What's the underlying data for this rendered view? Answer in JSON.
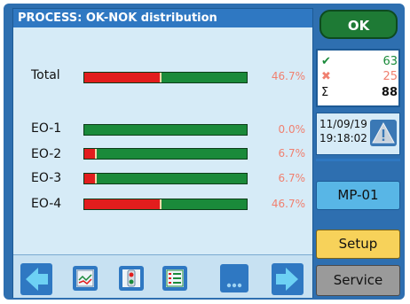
{
  "window": {
    "title": "PROCESS: OK-NOK distribution"
  },
  "rows": [
    {
      "label": "Total",
      "percent_text": "46.7%",
      "nok_fraction": 0.467
    },
    {
      "label": "EO-1",
      "percent_text": "0.0%",
      "nok_fraction": 0.0
    },
    {
      "label": "EO-2",
      "percent_text": "6.7%",
      "nok_fraction": 0.067
    },
    {
      "label": "EO-3",
      "percent_text": "6.7%",
      "nok_fraction": 0.067
    },
    {
      "label": "EO-4",
      "percent_text": "46.7%",
      "nok_fraction": 0.467
    }
  ],
  "side": {
    "ok_label": "OK",
    "counts": {
      "ok": {
        "symbol": "✔",
        "value": "63"
      },
      "nok": {
        "symbol": "✖",
        "value": "25"
      },
      "total": {
        "symbol": "Σ",
        "value": "88"
      }
    },
    "date": "11/09/19",
    "time": "19:18:02",
    "mp_label": "MP-01",
    "setup_label": "Setup",
    "service_label": "Service"
  },
  "colors": {
    "ok_bar": "#1a8a3a",
    "nok_bar": "#e21d1d",
    "percent_text": "#f08070",
    "ok_count": "#1a8a3a",
    "nok_count": "#f08070"
  },
  "toolbar": {
    "icons": [
      "arrow-left-icon",
      "trend-chart-icon",
      "traffic-light-icon",
      "list-icon",
      "more-icon",
      "arrow-right-icon"
    ]
  }
}
